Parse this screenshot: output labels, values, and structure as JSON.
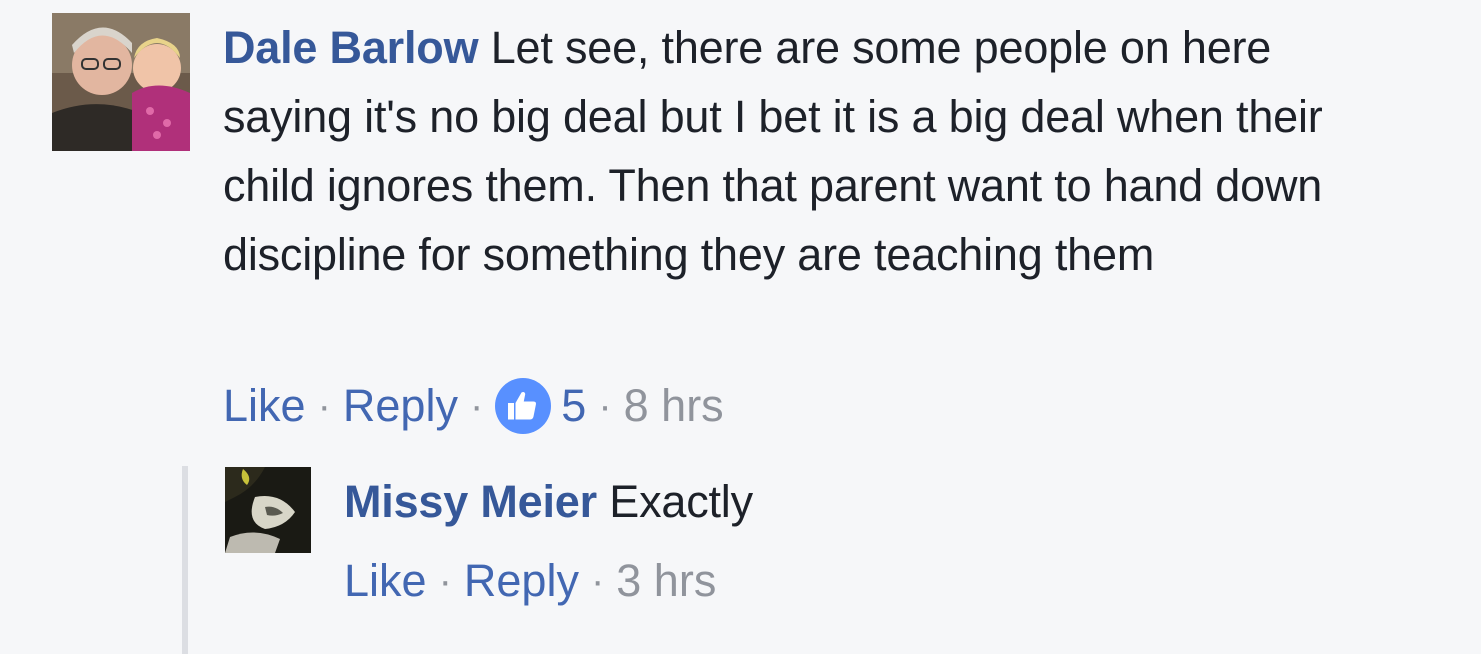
{
  "comment": {
    "author": "Dale Barlow",
    "text": "Let see, there are some people on here saying it's no big deal but I bet it is a big deal when their child ignores them. Then that parent want to hand down discipline for something they are teaching them",
    "actions": {
      "like": "Like",
      "reply": "Reply",
      "reaction_count": "5",
      "reaction_icon": "thumbs-up-icon",
      "time": "8 hrs"
    }
  },
  "reply": {
    "author": "Missy Meier",
    "text": "Exactly",
    "actions": {
      "like": "Like",
      "reply": "Reply",
      "time": "3 hrs"
    }
  },
  "separator": "·",
  "colors": {
    "author": "#365899",
    "link": "#4267b2",
    "muted": "#90949c",
    "reaction": "#5890ff",
    "background": "#f6f7f9"
  }
}
